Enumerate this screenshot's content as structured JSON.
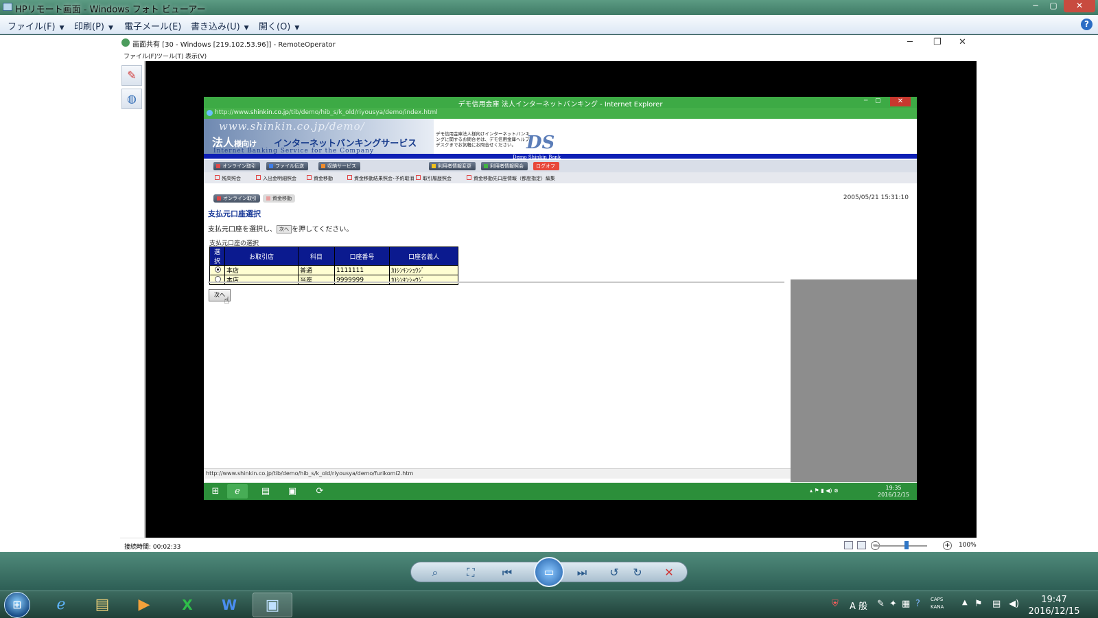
{
  "window": {
    "title": "HPリモート画面 - Windows フォト ビューアー",
    "minimize": "─",
    "maximize": "▢",
    "close": "✕"
  },
  "menubar": {
    "items": [
      {
        "label": "ファイル(F)"
      },
      {
        "label": "印刷(P)"
      },
      {
        "label": "電子メール(E)"
      },
      {
        "label": "書き込み(U)"
      },
      {
        "label": "開く(O)"
      }
    ],
    "help": "?"
  },
  "remote_operator": {
    "title": "画面共有 [30 - Windows [219.102.53.96]] - RemoteOperator",
    "menu": [
      "ファイル(F)",
      "ツール(T)",
      "表示(V)"
    ],
    "tools": [
      {
        "icon": "pen-icon"
      },
      {
        "icon": "globe-icon"
      }
    ],
    "status": {
      "connection_time": "接続時間: 00:02:33",
      "zoom": "100%"
    }
  },
  "ie": {
    "title": "デモ信用金庫 法人インターネットバンキング - Internet Explorer",
    "address": {
      "before": "http://www.",
      "domain": "shinkin.co.jp",
      "after": "/tib/demo/hib_s/k_old/riyousya/demo/index.html"
    },
    "status_url": "http://www.shinkin.co.jp/tib/demo/hib_s/k_old/riyousya/demo/furikomi2.htm"
  },
  "banner": {
    "domain_watermark": "www.shinkin.co.jp/demo/",
    "corp_label": "法人",
    "corp_suffix": "様向け",
    "service_title": "インターネットバンキングサービス",
    "service_subtitle": "Internet Banking Service for the Company",
    "note": "デモ信用金庫法人様向けインターネットバンキングに関するお問合せは、デモ信用金庫ヘルプデスクまでお気軽にお問合せください。",
    "logo_text": "DS",
    "bank_name": "Demo Shinkin Bank"
  },
  "nav": {
    "main": [
      {
        "label": "オンライン取引",
        "color": "r"
      },
      {
        "label": "ファイル伝送",
        "color": "b"
      },
      {
        "label": "収納サービス",
        "color": "o"
      },
      {
        "label": "利用者情報変更",
        "color": "y"
      },
      {
        "label": "利用者情報照会",
        "color": "g"
      },
      {
        "label": "ログオフ",
        "color": "logoff"
      }
    ],
    "sub": [
      "残高照会",
      "入出金明細照会",
      "資金移動",
      "資金移動結果照会･予約取消",
      "取引履歴照会",
      "資金移動先口座情報（都度指定）編集"
    ]
  },
  "page": {
    "breadcrumb": [
      "オンライン取引",
      "資金移動"
    ],
    "datetime": "2005/05/21 15:31:10",
    "title": "支払元口座選択",
    "instruction_before": "支払元口座を選択し、",
    "instruction_button": "次へ",
    "instruction_after": "を押してください。",
    "table_caption": "支払元口座の選択",
    "table": {
      "headers": [
        "選択",
        "お取引店",
        "科目",
        "口座番号",
        "口座名義人"
      ],
      "rows": [
        {
          "selected": true,
          "branch": "本店",
          "type": "普通",
          "number": "1111111",
          "holder": "ｶ)ｼﾝｷﾝｼｮｳｼﾞ"
        },
        {
          "selected": false,
          "branch": "本店",
          "type": "当座",
          "number": "9999999",
          "holder": "ｶ)ｼﾝｷﾝｼｮｳｼﾞ"
        }
      ]
    },
    "next_button": "次へ"
  },
  "remote_taskbar": {
    "time": "19:35",
    "date": "2016/12/15"
  },
  "viewer_controls": {
    "buttons": [
      "zoom-icon",
      "fit-icon",
      "previous-icon",
      "slideshow-icon",
      "next-icon",
      "rotate-left-icon",
      "rotate-right-icon",
      "delete-icon"
    ]
  },
  "taskbar": {
    "ime_mode": "A 般",
    "caps": "CAPS",
    "kana": "KANA",
    "time": "19:47",
    "date": "2016/12/15"
  }
}
